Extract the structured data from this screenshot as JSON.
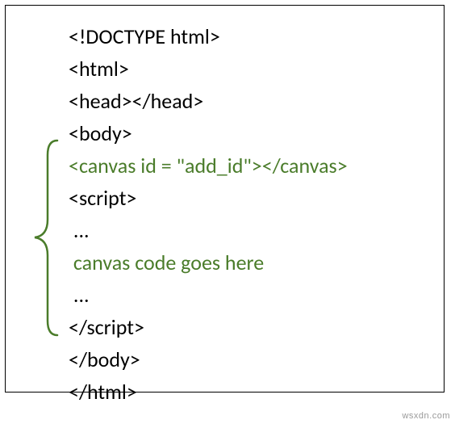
{
  "code": {
    "line1": "<!DOCTYPE html>",
    "line2": "<html>",
    "line3": "<head></head>",
    "line4": "<body>",
    "line5": "<canvas id = \"add_id\"></canvas>",
    "line6": "<script>",
    "line7": " ...",
    "line8": " canvas code goes here",
    "line9": " ...",
    "line10": "</script>",
    "line11": "</body>",
    "line12": "</html>"
  },
  "watermark": "wsxdn.com",
  "colors": {
    "highlight": "#4a7c2a",
    "bracket": "#4a7c2a"
  }
}
